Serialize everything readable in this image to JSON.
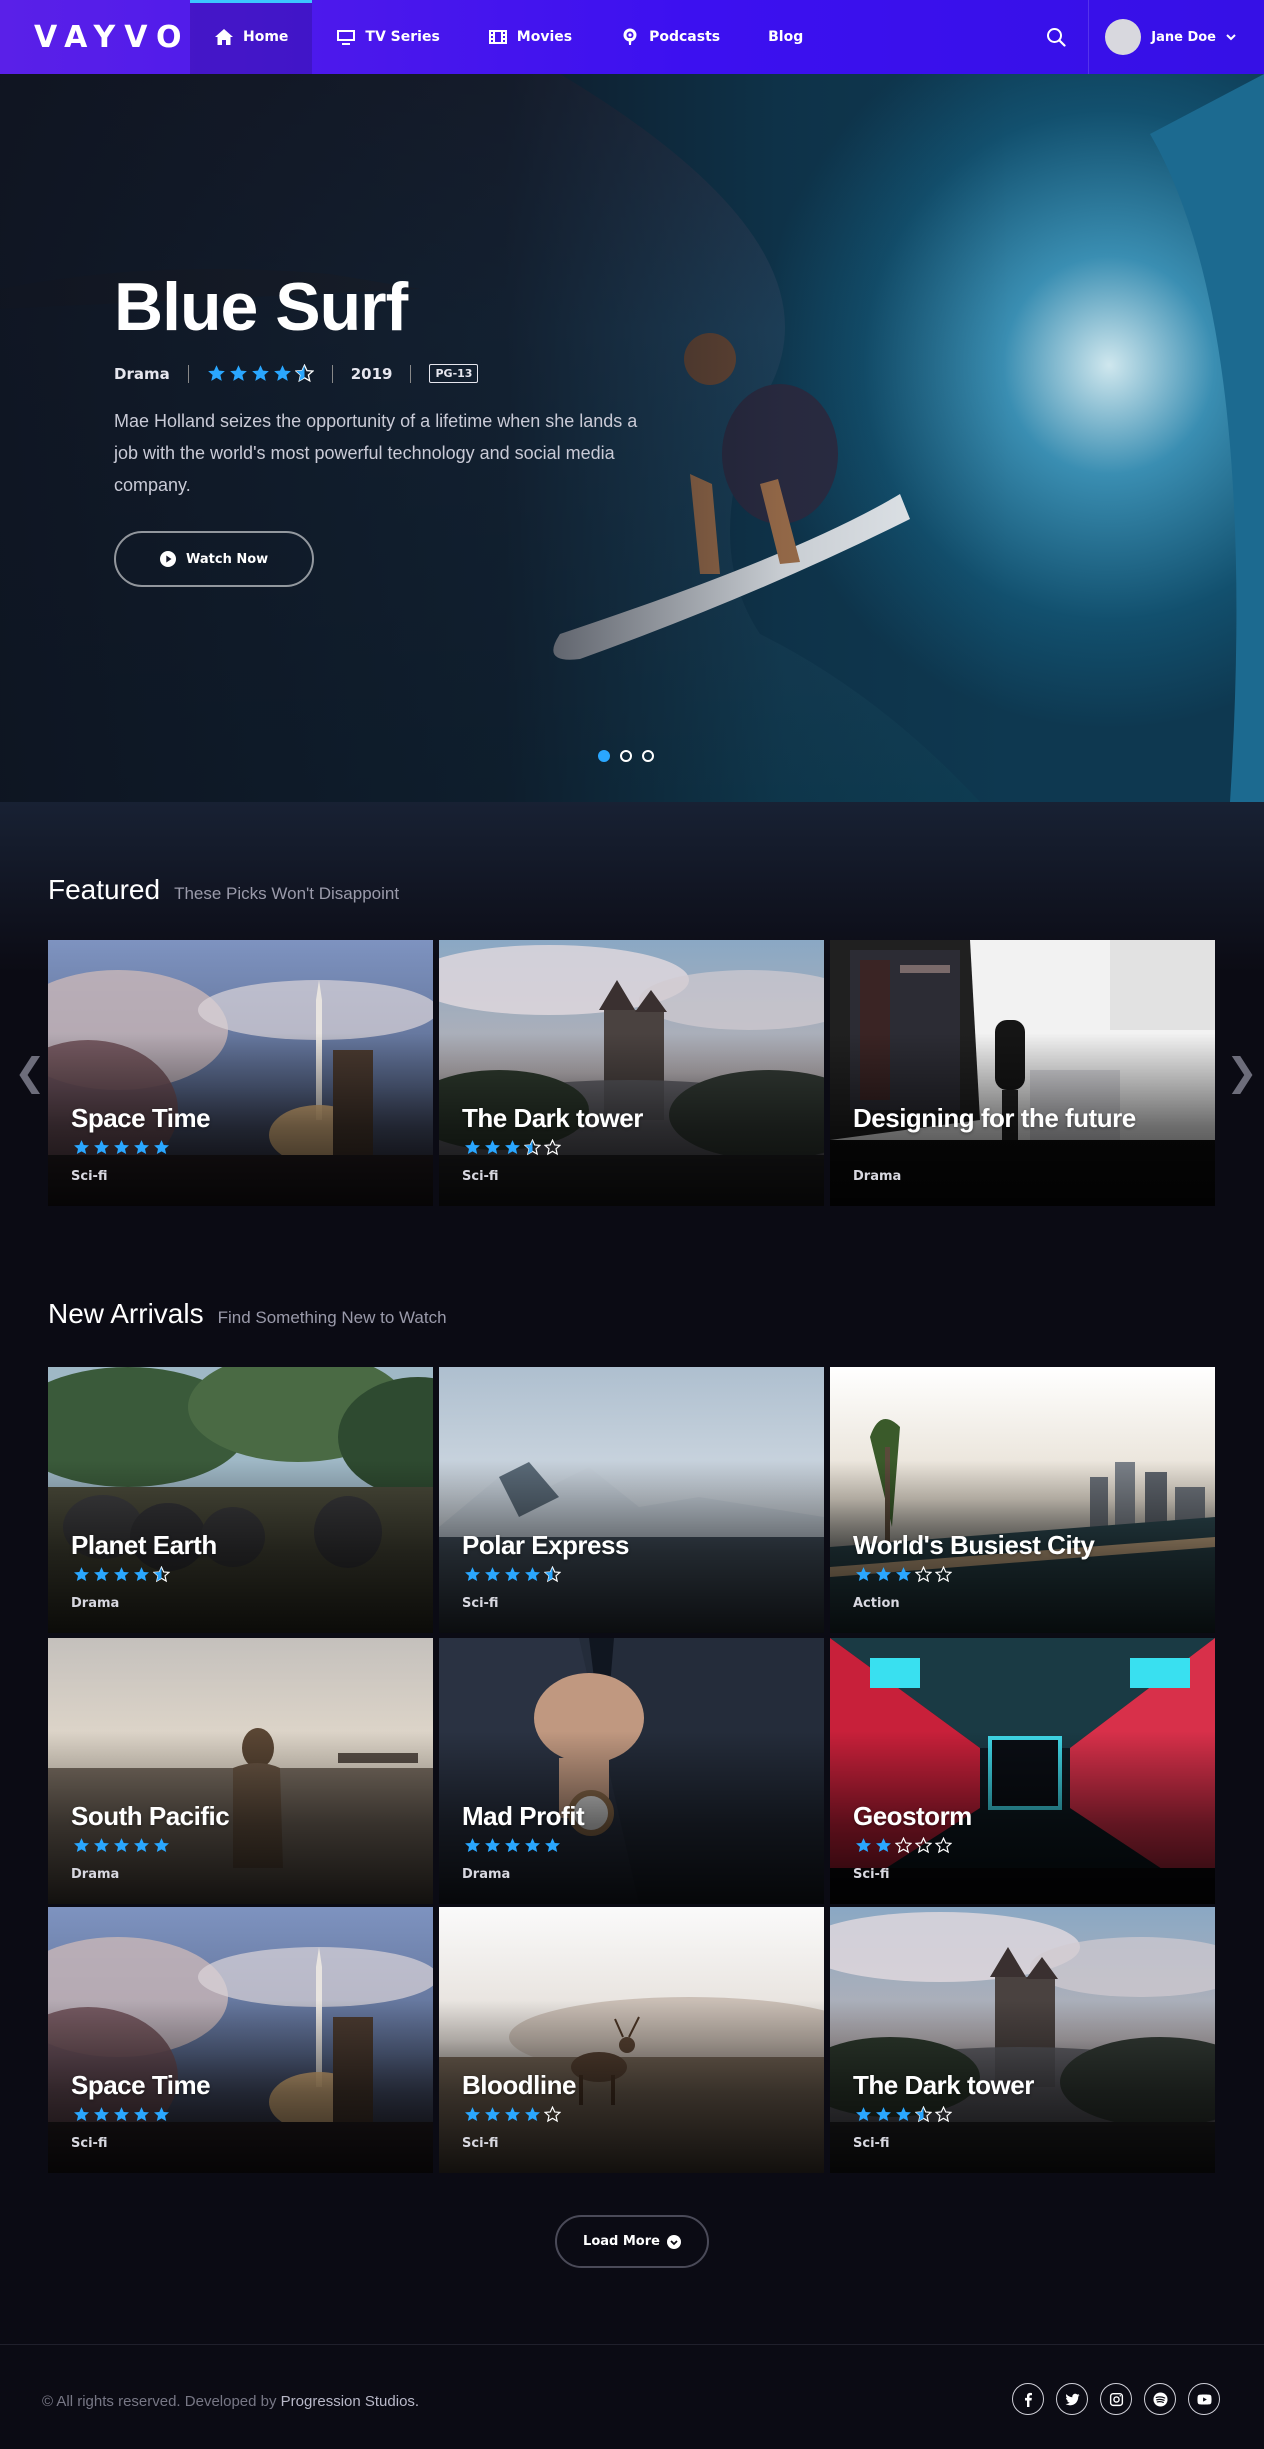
{
  "brand": {
    "logo": "VAYVO"
  },
  "nav": [
    {
      "label": "Home",
      "icon": "home-icon",
      "active": true
    },
    {
      "label": "TV Series",
      "icon": "tv-icon"
    },
    {
      "label": "Movies",
      "icon": "film-icon"
    },
    {
      "label": "Podcasts",
      "icon": "podcast-icon"
    },
    {
      "label": "Blog"
    }
  ],
  "user": {
    "name": "Jane Doe"
  },
  "colors": {
    "accent": "#2aa7ff",
    "header_start": "#5a20e8",
    "header_end": "#3610e6",
    "background": "#0b0b14",
    "star": "#2aa7ff"
  },
  "hero": {
    "title": "Blue Surf",
    "genre": "Drama",
    "rating": 4.5,
    "year": "2019",
    "content_rating": "PG-13",
    "description": "Mae Holland seizes the opportunity of a lifetime when she lands a job with the world's most powerful technology and social media company.",
    "cta": "Watch Now",
    "slides": 3,
    "active_slide": 1
  },
  "featured": {
    "title": "Featured",
    "subtitle": "These Picks Won't Disappoint",
    "items": [
      {
        "title": "Space Time",
        "rating": 5,
        "genre": "Sci-fi"
      },
      {
        "title": "The Dark tower",
        "rating": 3.5,
        "genre": "Sci-fi"
      },
      {
        "title": "Designing for the future",
        "rating": 0,
        "genre": "Drama"
      }
    ]
  },
  "arrivals": {
    "title": "New Arrivals",
    "subtitle": "Find Something New to Watch",
    "items": [
      {
        "title": "Planet Earth",
        "rating": 4.5,
        "genre": "Drama"
      },
      {
        "title": "Polar Express",
        "rating": 4.5,
        "genre": "Sci-fi"
      },
      {
        "title": "World's Busiest City",
        "rating": 3,
        "genre": "Action"
      },
      {
        "title": "South Pacific",
        "rating": 5,
        "genre": "Drama"
      },
      {
        "title": "Mad Profit",
        "rating": 5,
        "genre": "Drama"
      },
      {
        "title": "Geostorm",
        "rating": 2,
        "genre": "Sci-fi"
      },
      {
        "title": "Space Time",
        "rating": 5,
        "genre": "Sci-fi"
      },
      {
        "title": "Bloodline",
        "rating": 4,
        "genre": "Sci-fi"
      },
      {
        "title": "The Dark tower",
        "rating": 3.5,
        "genre": "Sci-fi"
      }
    ]
  },
  "load_more": "Load More",
  "footer": {
    "copyright": "© All rights reserved. Developed by",
    "developer": "Progression Studios.",
    "socials": [
      "facebook-icon",
      "twitter-icon",
      "instagram-icon",
      "spotify-icon",
      "youtube-icon"
    ]
  }
}
